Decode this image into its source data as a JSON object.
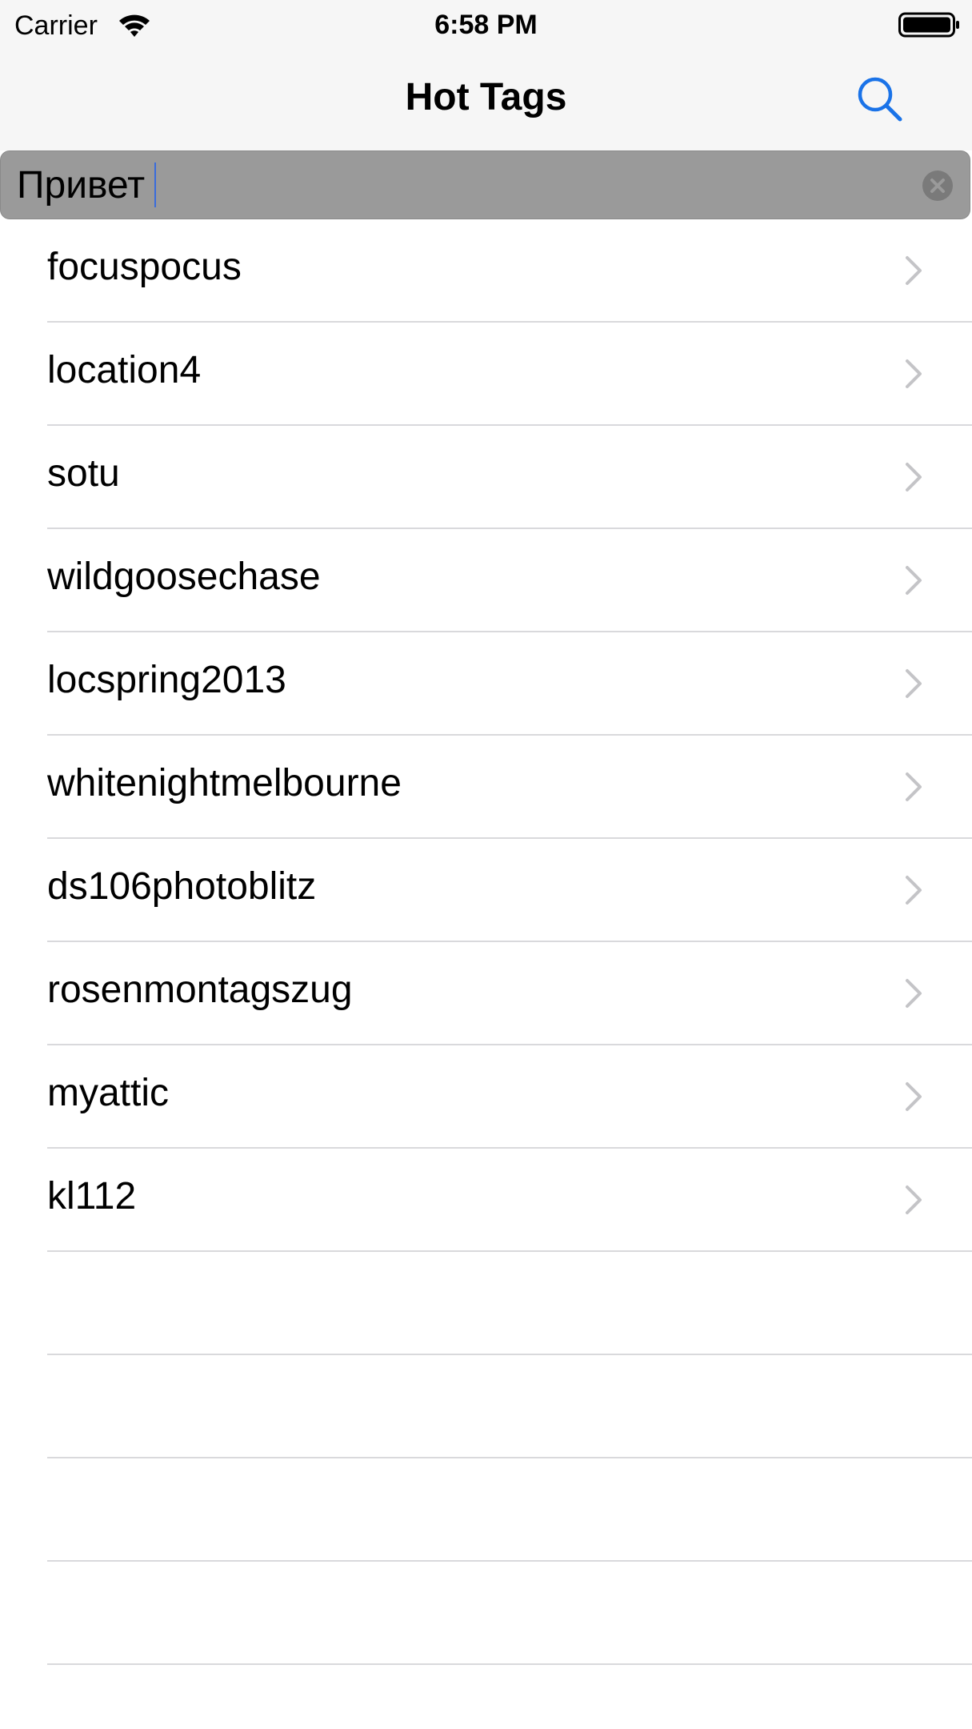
{
  "status_bar": {
    "carrier": "Carrier",
    "time": "6:58 PM",
    "wifi_icon": "wifi-icon",
    "battery_icon": "battery-icon"
  },
  "nav": {
    "title": "Hot Tags",
    "search_icon": "search-icon",
    "accent_color": "#1a73e8"
  },
  "search": {
    "value": "Привет",
    "clear_icon": "clear-icon"
  },
  "tags": [
    {
      "label": "focuspocus"
    },
    {
      "label": "location4"
    },
    {
      "label": "sotu"
    },
    {
      "label": "wildgoosechase"
    },
    {
      "label": "locspring2013"
    },
    {
      "label": "whitenightmelbourne"
    },
    {
      "label": "ds106photoblitz"
    },
    {
      "label": "rosenmontagszug"
    },
    {
      "label": "myattic"
    },
    {
      "label": "kl112"
    }
  ]
}
